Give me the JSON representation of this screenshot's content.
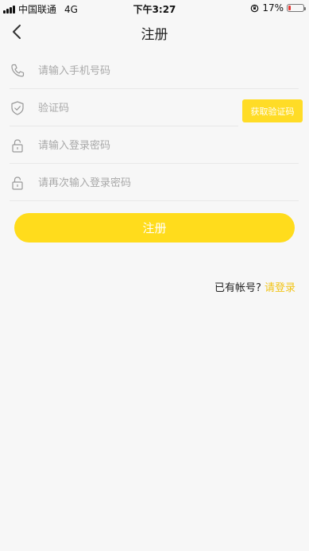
{
  "status_bar": {
    "carrier": "中国联通",
    "network": "4G",
    "time": "下午3:27",
    "battery_text": "17%",
    "battery_level": 0.17
  },
  "header": {
    "title": "注册",
    "back_icon": "chevron-left-icon"
  },
  "form": {
    "phone": {
      "placeholder": "请输入手机号码",
      "value": "",
      "icon": "phone-icon"
    },
    "code": {
      "placeholder": "验证码",
      "value": "",
      "icon": "shield-check-icon"
    },
    "get_code_label": "获取验证码",
    "password": {
      "placeholder": "请输入登录密码",
      "value": "",
      "icon": "lock-icon"
    },
    "password_confirm": {
      "placeholder": "请再次输入登录密码",
      "value": "",
      "icon": "lock-icon"
    }
  },
  "submit_label": "注册",
  "login_prompt": {
    "text": "已有帐号?",
    "link": "请登录"
  },
  "colors": {
    "accent": "#ffdc1c",
    "link": "#f2c417",
    "background": "#f7f7f7",
    "battery_low": "#e53935"
  }
}
